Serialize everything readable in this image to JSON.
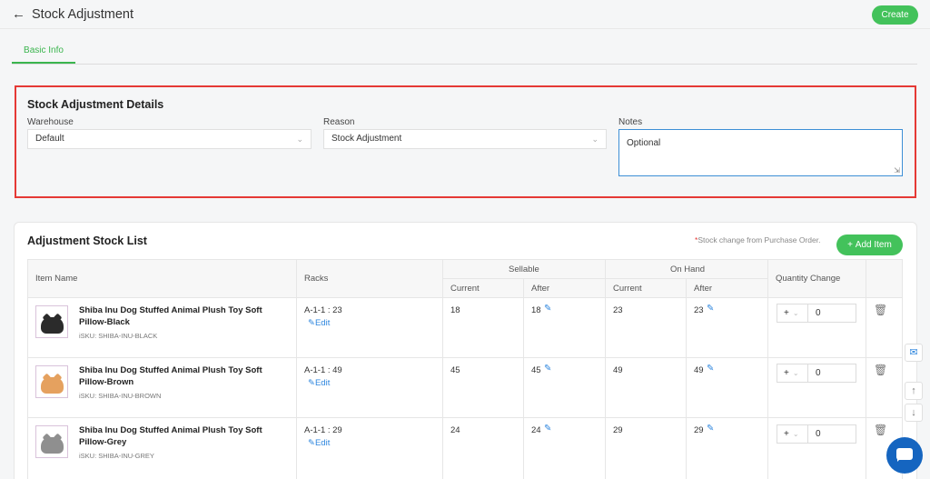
{
  "header": {
    "title": "Stock Adjustment",
    "create_label": "Create"
  },
  "tabs": [
    {
      "label": "Basic Info",
      "active": true
    }
  ],
  "details": {
    "title": "Stock Adjustment Details",
    "warehouse": {
      "label": "Warehouse",
      "value": "Default"
    },
    "reason": {
      "label": "Reason",
      "value": "Stock Adjustment"
    },
    "notes": {
      "label": "Notes",
      "placeholder": "Optional"
    }
  },
  "stock_list": {
    "title": "Adjustment Stock List",
    "note_star": "*",
    "note": "Stock change from Purchase Order.",
    "add_label": "Add Item",
    "columns": {
      "item_name": "Item Name",
      "racks": "Racks",
      "sellable": "Sellable",
      "on_hand": "On Hand",
      "current": "Current",
      "after": "After",
      "quantity_change": "Quantity Change"
    },
    "items": [
      {
        "name": "Shiba Inu Dog Stuffed Animal Plush Toy Soft Pillow-Black",
        "sku": "iSKU: SHIBA-INU-BLACK",
        "rack": "A-1-1 : 23",
        "edit": "Edit",
        "sellable_current": "18",
        "sellable_after": "18",
        "onhand_current": "23",
        "onhand_after": "23",
        "sign": "+",
        "qty": "0",
        "color": "#2b2b2b"
      },
      {
        "name": "Shiba Inu Dog Stuffed Animal Plush Toy Soft Pillow-Brown",
        "sku": "iSKU: SHIBA-INU-BROWN",
        "rack": "A-1-1 : 49",
        "edit": "Edit",
        "sellable_current": "45",
        "sellable_after": "45",
        "onhand_current": "49",
        "onhand_after": "49",
        "sign": "+",
        "qty": "0",
        "color": "#e5a15f"
      },
      {
        "name": "Shiba Inu Dog Stuffed Animal Plush Toy Soft Pillow-Grey",
        "sku": "iSKU: SHIBA-INU-GREY",
        "rack": "A-1-1 : 29",
        "edit": "Edit",
        "sellable_current": "24",
        "sellable_after": "24",
        "onhand_current": "29",
        "onhand_after": "29",
        "sign": "+",
        "qty": "0",
        "color": "#8f8f8f"
      }
    ]
  },
  "colors": {
    "accent": "#43c25b",
    "link": "#2e86de",
    "highlight": "#e53935",
    "chat": "#1565c0"
  }
}
